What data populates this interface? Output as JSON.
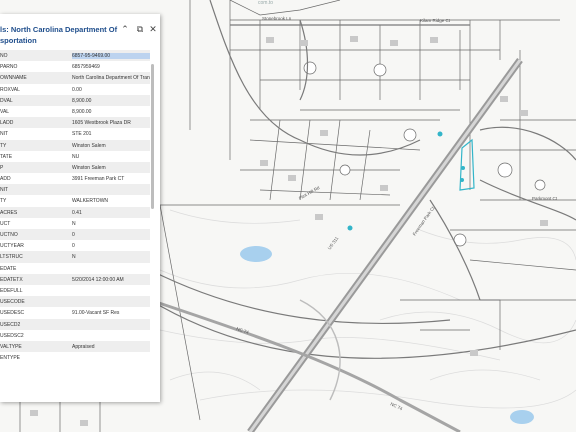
{
  "popup": {
    "title": "ls: North Carolina Department Of\nsportation",
    "controls": {
      "collapse": "⌃",
      "dock": "⧉",
      "close": "✕"
    },
    "rows": [
      {
        "key": "NO",
        "value": "6857-95-9469.00",
        "highlight": true
      },
      {
        "key": "PARNO",
        "value": "6857959469"
      },
      {
        "key": "OWNNAME",
        "value": "North Carolina Department Of Transportation"
      },
      {
        "key": "ROXVAL",
        "value": "0.00"
      },
      {
        "key": "DVAL",
        "value": "8,900.00"
      },
      {
        "key": "VAL",
        "value": "8,900.00"
      },
      {
        "key": "LADD",
        "value": "1605 Westbrook Plaza DR"
      },
      {
        "key": "NIT",
        "value": "STE 201"
      },
      {
        "key": "TY",
        "value": "Winston Salem"
      },
      {
        "key": "TATE",
        "value": "NU"
      },
      {
        "key": "P",
        "value": "Winston Salem"
      },
      {
        "key": "ADD",
        "value": "3991 Freeman Park CT"
      },
      {
        "key": "NIT",
        "value": ""
      },
      {
        "key": "TY",
        "value": "WALKERTOWN"
      },
      {
        "key": "ACRES",
        "value": "0.41"
      },
      {
        "key": "UCT",
        "value": "N"
      },
      {
        "key": "UCTNO",
        "value": "0"
      },
      {
        "key": "UCTYEAR",
        "value": "0"
      },
      {
        "key": "LTSTRUC",
        "value": "N"
      },
      {
        "key": "EDATE",
        "value": ""
      },
      {
        "key": "EDATETX",
        "value": "5/20/2014 12:00:00 AM"
      },
      {
        "key": "EDEFULL",
        "value": ""
      },
      {
        "key": "USECODE",
        "value": ""
      },
      {
        "key": "USEDESC",
        "value": "91.00-Vacant SF Res"
      },
      {
        "key": "USECD2",
        "value": ""
      },
      {
        "key": "USEDSC2",
        "value": ""
      },
      {
        "key": "VALTYPE",
        "value": "Appraised"
      },
      {
        "key": "ENTYPE",
        "value": ""
      }
    ]
  },
  "map": {
    "attribution": "com.to",
    "street_labels": [
      {
        "text": "Stonebrook Ln",
        "name": "label-stonebrook"
      },
      {
        "text": "Kilam Ridge Ct",
        "name": "label-kilam-ridge"
      },
      {
        "text": "Flint Hill Rd",
        "name": "label-flint-hill"
      },
      {
        "text": "Freeman Park Ct",
        "name": "label-freeman-park"
      },
      {
        "text": "Parkmont Ct",
        "name": "label-parkmont"
      },
      {
        "text": "NC 74",
        "name": "label-nc74-a"
      },
      {
        "text": "NC 74",
        "name": "label-nc74-b"
      },
      {
        "text": "US 311",
        "name": "label-us311"
      }
    ],
    "colors": {
      "road": "#8a8a8a",
      "parcel": "#666666",
      "water": "#a8d0ee",
      "highlight": "#33b5c9",
      "contour": "#d9d9d9"
    }
  }
}
